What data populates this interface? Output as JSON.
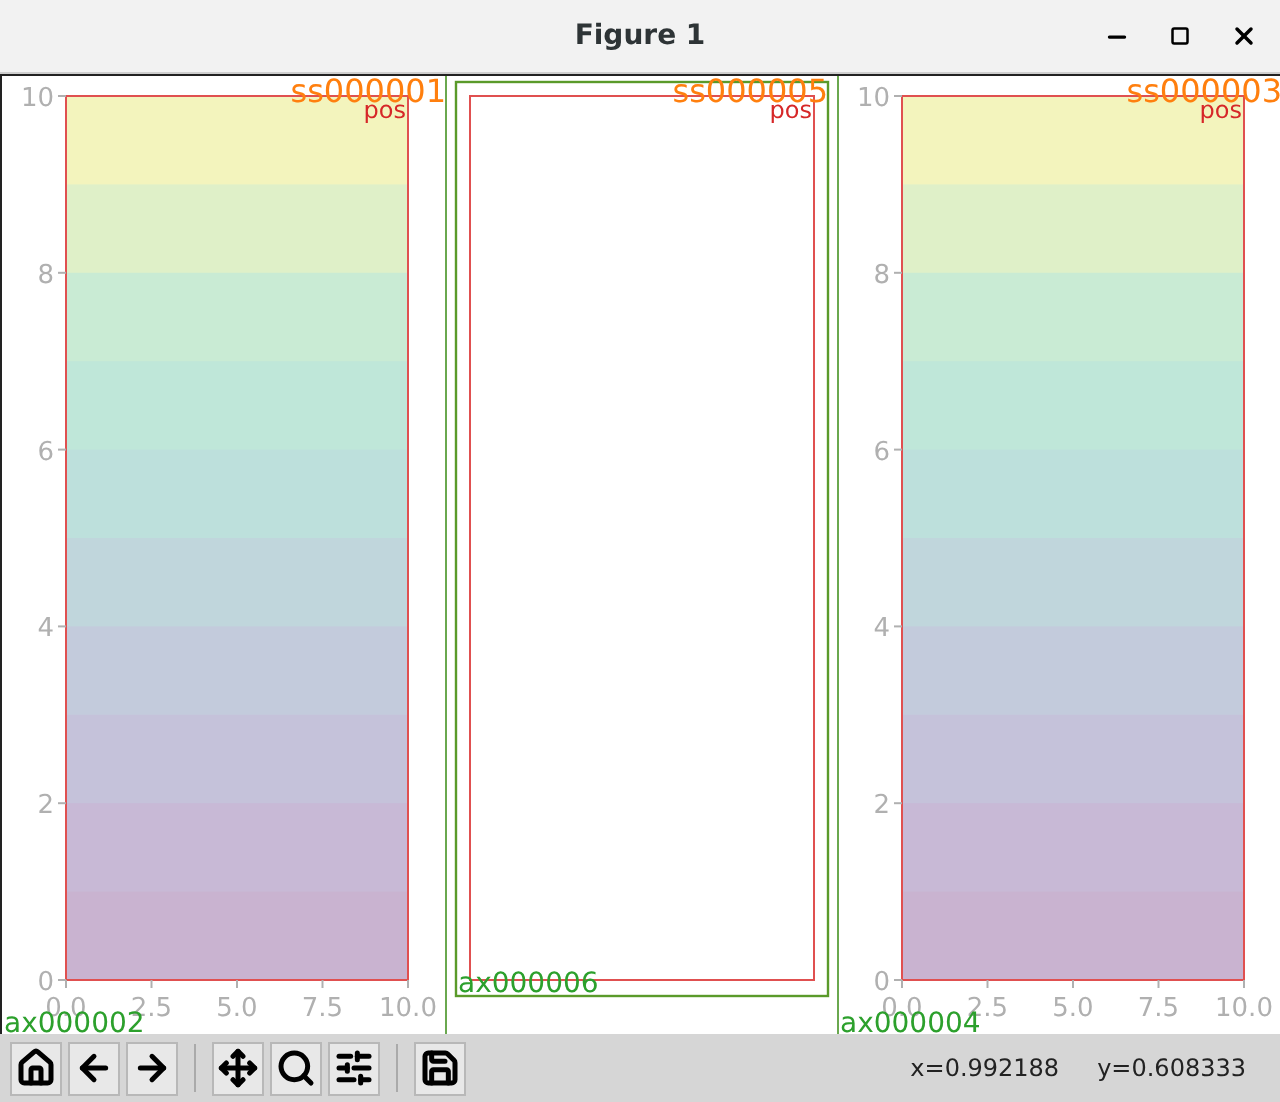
{
  "window": {
    "title": "Figure 1"
  },
  "panels": [
    {
      "kind": "image",
      "label": "ss000001",
      "axes_label": "ax000002",
      "inner_label": "pos",
      "yticks": [
        "10",
        "8",
        "6",
        "4",
        "2",
        "0"
      ],
      "xticks": [
        "0.0",
        "2.5",
        "5.0",
        "7.5",
        "10.0"
      ]
    },
    {
      "kind": "empty",
      "label": "ss000005",
      "axes_label": "ax000006",
      "inner_label": "pos"
    },
    {
      "kind": "image",
      "label": "ss000003",
      "axes_label": "ax000004",
      "inner_label": "pos",
      "yticks": [
        "10",
        "8",
        "6",
        "4",
        "2",
        "0"
      ],
      "xticks": [
        "0.0",
        "2.5",
        "5.0",
        "7.5",
        "10.0"
      ]
    }
  ],
  "toolbar": {
    "buttons": [
      {
        "kind": "home"
      },
      {
        "kind": "back"
      },
      {
        "kind": "forward"
      },
      {
        "kind": "separator"
      },
      {
        "kind": "pan"
      },
      {
        "kind": "zoom"
      },
      {
        "kind": "configure"
      },
      {
        "kind": "separator"
      },
      {
        "kind": "save"
      }
    ]
  },
  "status": {
    "x": "x=0.992188",
    "y": "y=0.608333"
  }
}
